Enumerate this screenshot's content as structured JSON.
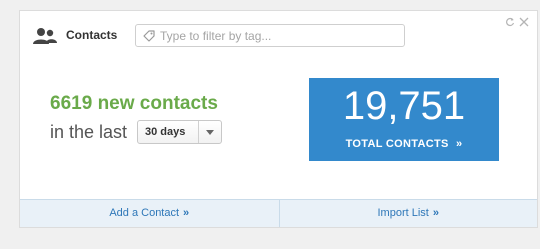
{
  "colors": {
    "page_background": "#f0f0f0",
    "new_contacts_text": "#6aaa4a",
    "total_box": "#3389cc",
    "footer_background": "#e9f1f8",
    "link": "#2e77b8"
  },
  "header": {
    "title": "Contacts",
    "icon": "contacts-icon",
    "filter": {
      "placeholder": "Type to filter by tag...",
      "value": "",
      "icon": "tag-icon"
    },
    "controls": [
      "refresh-icon",
      "close-icon"
    ]
  },
  "summary": {
    "new_count": "6619",
    "new_label": "new contacts",
    "period_prefix": "in the last",
    "period_selected": "30 days"
  },
  "total": {
    "value": "19,751",
    "label": "TOTAL CONTACTS",
    "chevron": "»"
  },
  "footer": {
    "add_label": "Add a Contact",
    "import_label": "Import List",
    "chevron": "»"
  }
}
